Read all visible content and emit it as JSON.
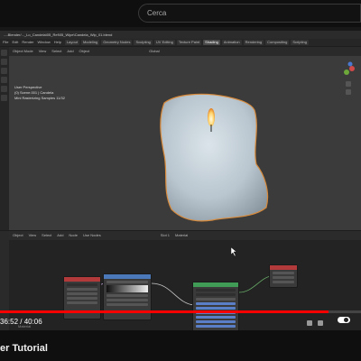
{
  "search": {
    "placeholder": "Cerca"
  },
  "blender": {
    "title": "...-Blender/..._Lo_Candela\\05_Ref\\05_Wipe\\Candela_Wip_01.blend",
    "menus": [
      "File",
      "Edit",
      "Render",
      "Window",
      "Help"
    ],
    "workspaces": [
      "UV Editing",
      "Layout",
      "Modeling",
      "Geometry Nodes",
      "Sculpting",
      "UV Editing",
      "Texture Paint",
      "Shading",
      "Animation",
      "Rendering",
      "Compositing",
      "Scripting"
    ],
    "active_workspace": "Shading",
    "viewport": {
      "mode": "Object Mode",
      "menus": [
        "View",
        "Select",
        "Add",
        "Object"
      ],
      "orientation": "Global",
      "info": [
        "User Perspective",
        "(0) Scene.001 | Candela",
        "Mini Rasterizing Samples 11/32"
      ]
    },
    "node_editor": {
      "mode": "Object",
      "menus": [
        "View",
        "Select",
        "Add",
        "Node"
      ],
      "use_nodes": "Use Nodes",
      "slot": "Slot 1",
      "material": "Material",
      "footer": "Material"
    }
  },
  "player": {
    "progress_fraction": 0.91,
    "time": "36:52 / 40:06"
  },
  "video": {
    "title": "er Tutorial"
  },
  "colors": {
    "progress": "#ff0000",
    "node_bsdf": "#3f9b56",
    "node_texture": "#4a78b8",
    "node_output": "#b23a3a"
  }
}
